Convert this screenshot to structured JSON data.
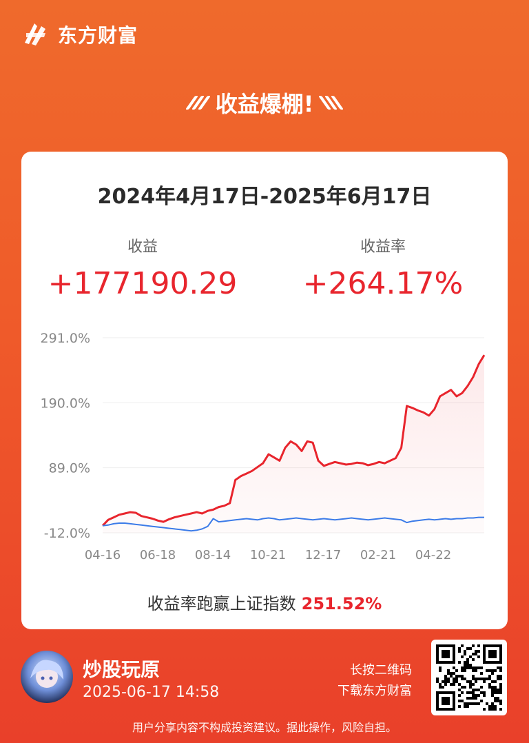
{
  "brand": {
    "name": "东方财富",
    "icon": "dongfang-logo-icon"
  },
  "headline": {
    "text": "收益爆棚!"
  },
  "card": {
    "date_range": "2024年4月17日-2025年6月17日",
    "profit": {
      "label": "收益",
      "value": "+177190.29"
    },
    "rate": {
      "label": "收益率",
      "value": "+264.17%"
    },
    "compare": {
      "label": "收益率跑赢上证指数",
      "value": "251.52%"
    }
  },
  "chart_data": {
    "type": "line",
    "x_ticks": [
      "04-16",
      "06-18",
      "08-14",
      "10-21",
      "12-17",
      "02-21",
      "04-22"
    ],
    "y_ticks": [
      "291.0%",
      "190.0%",
      "89.0%",
      "-12.0%"
    ],
    "ylim": [
      -12,
      291
    ],
    "grid": true,
    "series": [
      {
        "color": "#e8252d",
        "values": [
          -1,
          8,
          12,
          16,
          18,
          20,
          19,
          14,
          12,
          10,
          7,
          5,
          9,
          12,
          14,
          16,
          18,
          20,
          18,
          22,
          24,
          28,
          30,
          34,
          70,
          76,
          80,
          84,
          90,
          96,
          110,
          105,
          100,
          120,
          130,
          125,
          115,
          130,
          128,
          100,
          92,
          95,
          98,
          96,
          94,
          95,
          97,
          96,
          93,
          95,
          98,
          96,
          100,
          104,
          120,
          185,
          182,
          178,
          175,
          170,
          180,
          200,
          205,
          210,
          200,
          205,
          216,
          230,
          250,
          264
        ]
      },
      {
        "color": "#3b7be8",
        "values": [
          -1,
          0,
          2,
          3,
          3,
          2,
          1,
          0,
          -1,
          -2,
          -3,
          -4,
          -5,
          -6,
          -7,
          -8,
          -9,
          -8,
          -6,
          -2,
          10,
          5,
          6,
          7,
          8,
          9,
          10,
          9,
          8,
          10,
          11,
          10,
          8,
          9,
          10,
          11,
          10,
          9,
          8,
          9,
          10,
          9,
          8,
          9,
          10,
          11,
          10,
          9,
          8,
          9,
          10,
          11,
          10,
          9,
          8,
          4,
          6,
          7,
          8,
          9,
          8,
          9,
          10,
          9,
          10,
          10,
          11,
          11,
          12,
          12
        ]
      }
    ]
  },
  "footer": {
    "avatar": "user-avatar",
    "user_name": "炒股玩原",
    "timestamp": "2025-06-17 14:58",
    "qr_hint_1": "长按二维码",
    "qr_hint_2": "下载东方财富",
    "disclaimer": "用户分享内容不构成投资建议。据此操作，风险自担。"
  }
}
